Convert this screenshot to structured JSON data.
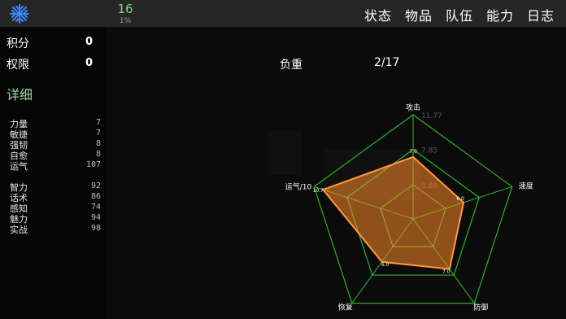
{
  "header": {
    "level": "16",
    "progress": "1%",
    "progress_fraction": 0.01,
    "menu": [
      "状态",
      "物品",
      "队伍",
      "能力",
      "日志"
    ],
    "logo_icon": "snowflake-emblem-icon"
  },
  "summary": {
    "points_label": "积分",
    "points_value": "0",
    "authority_label": "权限",
    "authority_value": "0",
    "weight_label": "负重",
    "weight_value": "2/17"
  },
  "details": {
    "title": "详细",
    "group1": [
      {
        "name": "力量",
        "value": "7"
      },
      {
        "name": "敏捷",
        "value": "7"
      },
      {
        "name": "强韧",
        "value": "8"
      },
      {
        "name": "自愈",
        "value": "8"
      },
      {
        "name": "运气",
        "value": "107"
      }
    ],
    "group2": [
      {
        "name": "智力",
        "value": "92"
      },
      {
        "name": "话术",
        "value": "86"
      },
      {
        "name": "感知",
        "value": "74"
      },
      {
        "name": "魅力",
        "value": "94"
      },
      {
        "name": "实战",
        "value": "98"
      }
    ]
  },
  "radar": {
    "axes": [
      "攻击",
      "速度",
      "防御",
      "恢复",
      "运气/10"
    ],
    "values": [
      7.0,
      6.0,
      7.0,
      6.0,
      10.7
    ],
    "value_labels": [
      "7.0",
      "6.0",
      "7.0",
      "6.0",
      "10.7"
    ],
    "rings": [
      3.88,
      7.85,
      11.77
    ],
    "ring_labels": [
      "3.88",
      "7.85",
      "11.77"
    ],
    "colors": {
      "grid": "#2bb52b",
      "fill": "#ff8a2a",
      "stroke": "#ff9a3a"
    }
  }
}
